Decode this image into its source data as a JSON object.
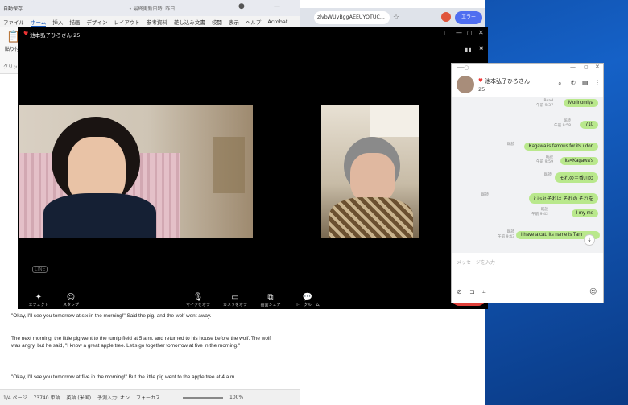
{
  "word": {
    "autosave": "自動保存",
    "title_hint": "• 最終更新日時: 昨日",
    "menu": [
      "ファイル",
      "ホーム",
      "挿入",
      "描画",
      "デザイン",
      "レイアウト",
      "参考資料",
      "差し込み文書",
      "校閲",
      "表示",
      "ヘルプ",
      "Acrobat"
    ],
    "paste_label": "貼り付",
    "clipboard_label": "クリッ",
    "doc_lines": [
      "\"Okay, I'll see you tomorrow at six in the morning!\" Said the pig, and the wolf went away.",
      "The next morning, the little pig went to the turnip field at 5 a.m. and returned to his house before the wolf. The wolf was angry, but he said, \"I know a great apple tree. Let's go together tomorrow at five in the morning.\"",
      "\"Okay, I'll see you tomorrow at five in the morning!\" But the little pig went to the apple tree at 4 a.m."
    ],
    "status": {
      "page": "1/4 ページ",
      "words": "73740 単語",
      "lang": "英語 (米国)",
      "ime": "予測入力: オン",
      "focus": "フォーカス",
      "zoom": "100%"
    }
  },
  "browser": {
    "url": "zlvbWUyBggAEEUYOTUC...",
    "error_button": "エラー"
  },
  "call": {
    "title": "池本弘子ひろさん 25",
    "controls": [
      {
        "label": "エフェクト",
        "icon": "effect-icon"
      },
      {
        "label": "スタンプ",
        "icon": "stamp-icon"
      },
      {
        "label": "マイクをオフ",
        "icon": "mic-icon"
      },
      {
        "label": "カメラをオフ",
        "icon": "camera-icon"
      },
      {
        "label": "画面シェア",
        "icon": "screen-share-icon"
      },
      {
        "label": "トークルーム",
        "icon": "chat-icon"
      }
    ]
  },
  "chat": {
    "name": "池本弘子ひろさん",
    "count": "25",
    "messages": [
      {
        "text": "Morinomiya",
        "read": "Read",
        "time": "午前 9:37"
      },
      {
        "text": "710",
        "read": "既読",
        "time": "午前 9:58"
      },
      {
        "text": "Kagawa is famous for its udon",
        "read": "既読",
        "time": ""
      },
      {
        "text": "its=Kagawa's",
        "read": "既読",
        "time": "午前 9:59"
      },
      {
        "text": "それの＝香川の",
        "read": "既読",
        "time": ""
      },
      {
        "text": "it  its  it  それは  それの  それを",
        "read": "既読",
        "time": ""
      },
      {
        "text": "I  my  me",
        "read": "既読",
        "time": "午前 9:42"
      },
      {
        "text": "I have a cat. Its name is Tam",
        "read": "既読",
        "time": "午前 9:43"
      }
    ],
    "input_placeholder": "メッセージを入力",
    "colors": {
      "bubble": "#b9e88c",
      "accent": "#06c755"
    }
  }
}
